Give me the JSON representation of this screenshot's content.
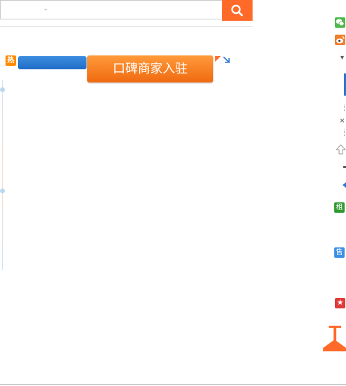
{
  "search": {
    "value": "",
    "placeholder": "",
    "dropdown_icon": "chevron-down-icon",
    "button_icon": "search-icon"
  },
  "hot_badge": "热",
  "merchant_button_label": "口碑商家入驻",
  "expand_icon": "expand-arrow-icon",
  "right_rail": {
    "wechat_icon": "wechat-icon",
    "weibo_icon": "weibo-icon",
    "rent_label": "租",
    "sale_label": "售",
    "close_glyph": "×",
    "favorite_icon": "star-icon",
    "back_to_top_icon": "back-to-top-icon"
  },
  "colors": {
    "accent": "#ff6a29",
    "cta": "#f57a1e",
    "blue": "#2a78d2"
  }
}
